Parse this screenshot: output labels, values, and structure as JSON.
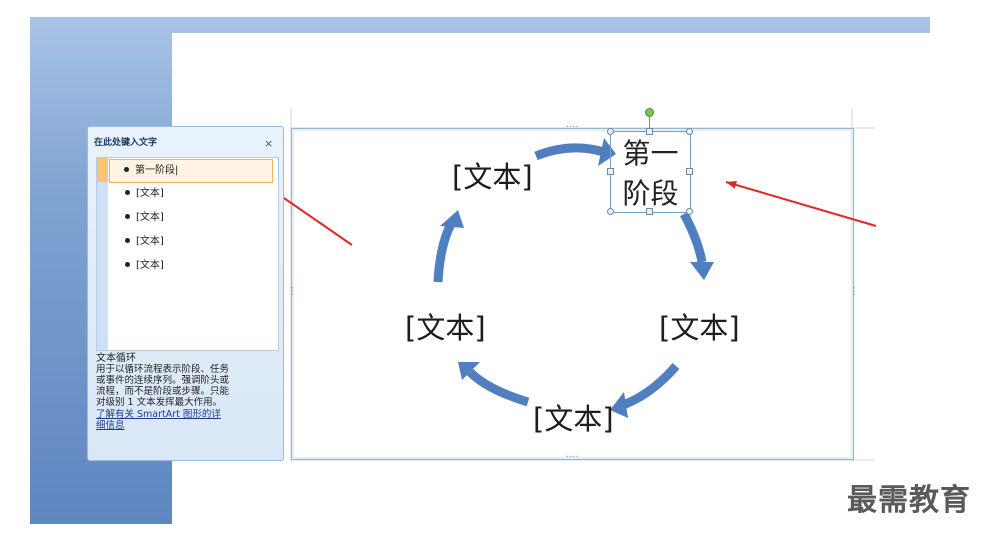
{
  "text_pane": {
    "title": "在此处键入文字",
    "close_glyph": "×",
    "items": [
      {
        "text": "第一阶段",
        "active": true
      },
      {
        "text": "[文本]",
        "active": false
      },
      {
        "text": "[文本]",
        "active": false
      },
      {
        "text": "[文本]",
        "active": false
      },
      {
        "text": "[文本]",
        "active": false
      }
    ],
    "desc_title": "文本循环",
    "desc_lines": [
      "用于以循环流程表示阶段、任务",
      "或事件的连续序列。强调阶头或",
      "流程，而不是阶段或步骤。只能",
      "对级别 1 文本发挥最大作用。"
    ],
    "link_lines": [
      "了解有关 SmartArt 图形的详",
      "细信息"
    ]
  },
  "diagram": {
    "selected_node_lines": [
      "第一",
      "阶段"
    ],
    "node_right": "[文本]",
    "node_bottom": "[文本]",
    "node_left": "[文本]",
    "node_top_left": "[文本]",
    "arrow_color": "#4f7fbe"
  },
  "annotation": {
    "arrow_color": "#e02a2a"
  },
  "watermark": "最需教育"
}
